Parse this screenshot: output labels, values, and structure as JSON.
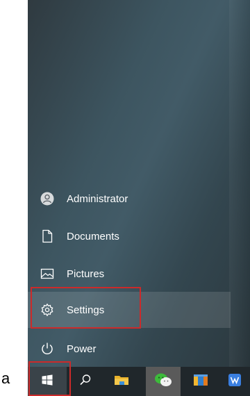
{
  "caption": "a",
  "start_menu": {
    "items": [
      {
        "label": "Administrator",
        "icon": "user-avatar-icon"
      },
      {
        "label": "Documents",
        "icon": "document-icon"
      },
      {
        "label": "Pictures",
        "icon": "pictures-icon"
      },
      {
        "label": "Settings",
        "icon": "gear-icon"
      },
      {
        "label": "Power",
        "icon": "power-icon"
      }
    ],
    "highlighted_item": "Settings"
  },
  "taskbar": {
    "items": [
      {
        "name": "start",
        "icon": "windows-start-icon",
        "highlighted": true
      },
      {
        "name": "search",
        "icon": "search-icon"
      },
      {
        "name": "file-explorer",
        "icon": "folder-icon"
      },
      {
        "name": "wechat",
        "icon": "wechat-icon"
      },
      {
        "name": "archive-app",
        "icon": "archive-icon"
      },
      {
        "name": "app",
        "icon": "app-icon"
      }
    ]
  },
  "colors": {
    "annotation_red": "#cc2a2a",
    "panel_bg": "#3d5560",
    "taskbar_bg": "#20272b"
  }
}
